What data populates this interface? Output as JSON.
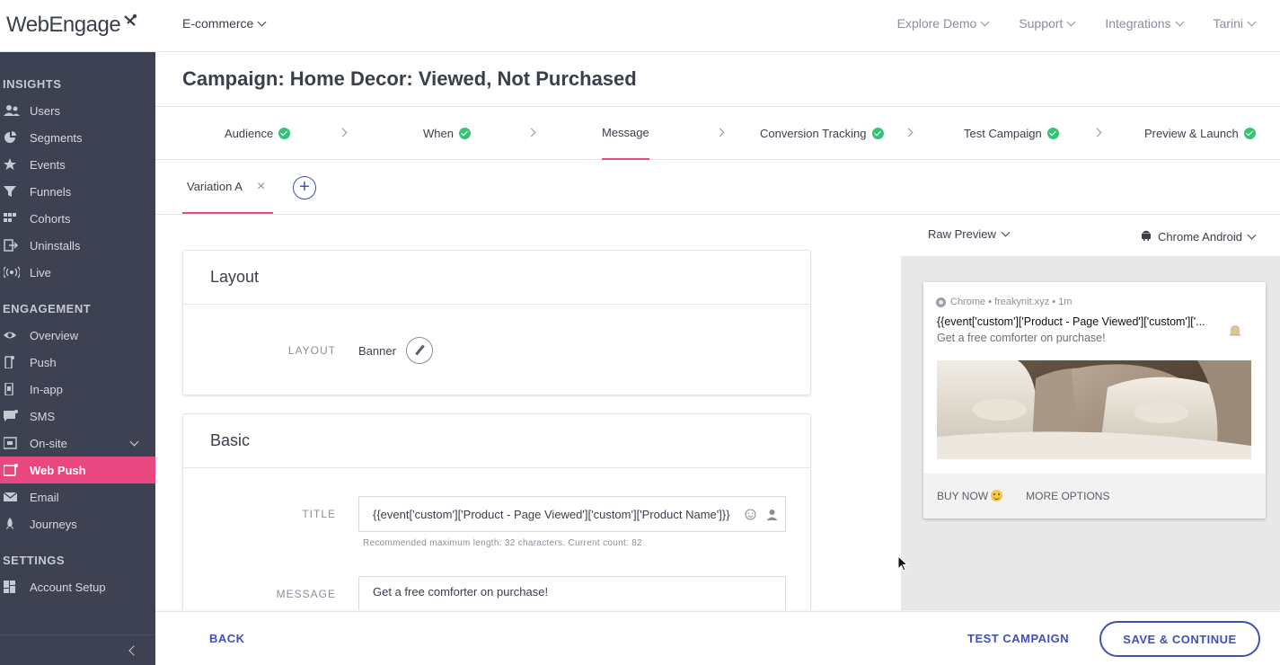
{
  "header": {
    "logo_text": "WebEngage",
    "project": "E-commerce",
    "nav": [
      {
        "label": "Explore Demo"
      },
      {
        "label": "Support"
      },
      {
        "label": "Integrations"
      },
      {
        "label": "Tarini"
      }
    ]
  },
  "sidebar": {
    "sections": [
      {
        "title": "INSIGHTS",
        "items": [
          {
            "label": "Users",
            "icon": "users-icon"
          },
          {
            "label": "Segments",
            "icon": "pie-icon"
          },
          {
            "label": "Events",
            "icon": "star-icon"
          },
          {
            "label": "Funnels",
            "icon": "funnel-icon"
          },
          {
            "label": "Cohorts",
            "icon": "grid-icon"
          },
          {
            "label": "Uninstalls",
            "icon": "exit-icon"
          },
          {
            "label": "Live",
            "icon": "broadcast-icon"
          }
        ]
      },
      {
        "title": "ENGAGEMENT",
        "items": [
          {
            "label": "Overview",
            "icon": "eye-icon"
          },
          {
            "label": "Push",
            "icon": "phone-icon"
          },
          {
            "label": "In-app",
            "icon": "mobile-icon"
          },
          {
            "label": "SMS",
            "icon": "chat-icon"
          },
          {
            "label": "On-site",
            "icon": "browser-icon"
          },
          {
            "label": "Web Push",
            "icon": "monitor-icon"
          },
          {
            "label": "Email",
            "icon": "mail-icon"
          },
          {
            "label": "Journeys",
            "icon": "rocket-icon"
          }
        ]
      },
      {
        "title": "SETTINGS",
        "items": [
          {
            "label": "Account Setup",
            "icon": "dashboard-icon"
          }
        ]
      }
    ]
  },
  "page": {
    "title": "Campaign: Home Decor: Viewed, Not Purchased"
  },
  "steps": [
    {
      "label": "Audience",
      "done": true
    },
    {
      "label": "When",
      "done": true
    },
    {
      "label": "Message",
      "done": false,
      "active": true
    },
    {
      "label": "Conversion Tracking",
      "done": true
    },
    {
      "label": "Test Campaign",
      "done": true
    },
    {
      "label": "Preview & Launch",
      "done": true
    }
  ],
  "variations": {
    "tab_label": "Variation A",
    "close_glyph": "×",
    "add_glyph": "+"
  },
  "layout_card": {
    "heading": "Layout",
    "field_label": "LAYOUT",
    "value": "Banner"
  },
  "basic_card": {
    "heading": "Basic",
    "title_label": "TITLE",
    "title_value": "{{event['custom']['Product - Page Viewed']['custom']['Product Name']}}",
    "title_hint": "Recommended maximum length: 32 characters. Current count: 82",
    "message_label": "MESSAGE",
    "message_value": "Get a free comforter on purchase!"
  },
  "preview": {
    "mode": "Raw Preview",
    "device": "Chrome Android",
    "notification": {
      "meta": "Chrome • freakynit.xyz • 1m",
      "title": "{{event['custom']['Product - Page Viewed']['custom']['...",
      "message": "Get a free comforter on purchase!",
      "actions": [
        {
          "label": "BUY NOW"
        },
        {
          "label": "MORE OPTIONS"
        }
      ]
    }
  },
  "footer": {
    "back": "BACK",
    "test": "TEST CAMPAIGN",
    "save": "SAVE & CONTINUE"
  },
  "colors": {
    "accent": "#e8477f",
    "primary": "#3f51b5",
    "sidebar_bg": "#3d4152",
    "success": "#36c377"
  }
}
